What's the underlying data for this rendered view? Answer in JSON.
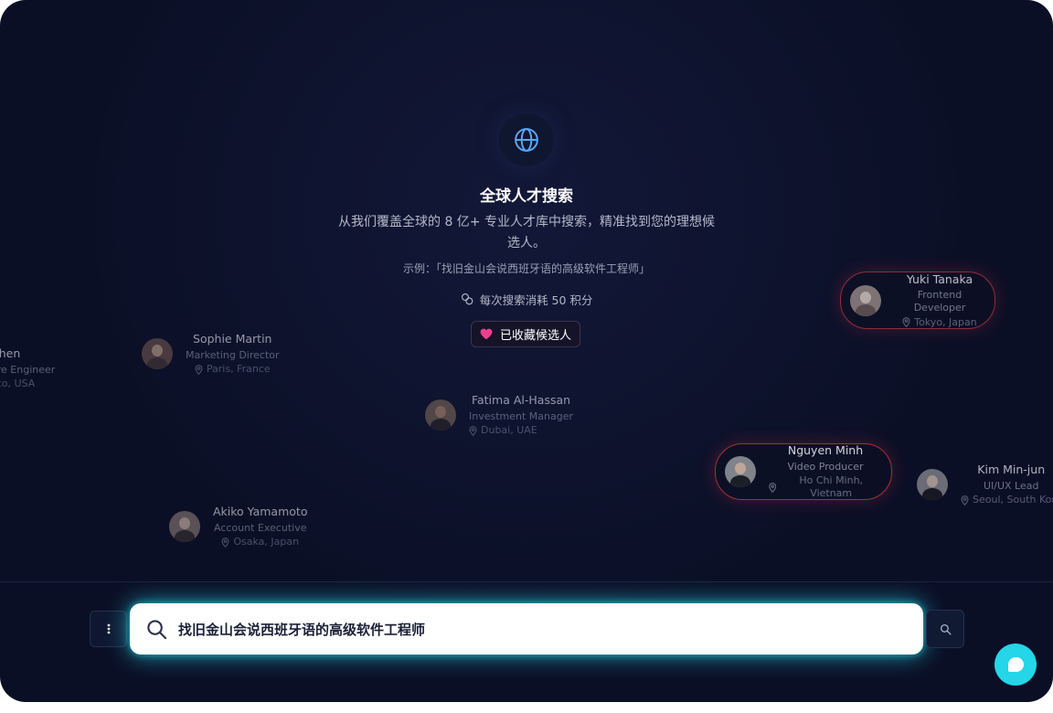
{
  "hero": {
    "title": "全球人才搜索",
    "subtitle": "从我们覆盖全球的 8 亿+ 专业人才库中搜索，精准找到您的理想候选人。",
    "example": "示例：「找旧金山会说西班牙语的高级软件工程师」",
    "cost": "每次搜索消耗 50 积分",
    "favorites_label": "已收藏候选人"
  },
  "candidates": [
    {
      "name": "Chen",
      "role": "are Engineer",
      "location": "sco, USA"
    },
    {
      "name": "Sophie Martin",
      "role": "Marketing Director",
      "location": "Paris, France"
    },
    {
      "name": "Fatima Al-Hassan",
      "role": "Investment Manager",
      "location": "Dubai, UAE"
    },
    {
      "name": "Akiko Yamamoto",
      "role": "Account Executive",
      "location": "Osaka, Japan"
    },
    {
      "name": "Yuki Tanaka",
      "role": "Frontend Developer",
      "location": "Tokyo, Japan"
    },
    {
      "name": "Nguyen Minh",
      "role": "Video Producer",
      "location": "Ho Chi Minh, Vietnam"
    },
    {
      "name": "Kim Min-jun",
      "role": "UI/UX Lead",
      "location": "Seoul, South Kore"
    }
  ],
  "search": {
    "value": "找旧金山会说西班牙语的高级软件工程师"
  },
  "icons": {
    "globe": "globe-icon",
    "coins": "coins-icon",
    "heart": "heart-icon",
    "location": "location-pin-icon",
    "search": "search-icon",
    "menu": "more-vertical-icon",
    "chat": "chat-bubble-icon"
  },
  "colors": {
    "background": "#0b0f26",
    "accent_cyan": "#24d6e8",
    "highlight_red": "#b0343d",
    "heart_pink": "#ec3f8c",
    "globe_blue": "#5aa6f5"
  }
}
